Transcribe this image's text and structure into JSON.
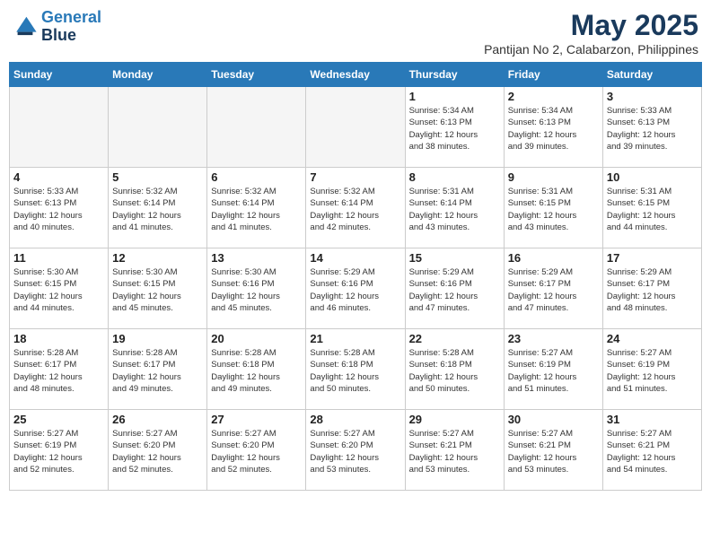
{
  "header": {
    "logo_line1": "General",
    "logo_line2": "Blue",
    "month_title": "May 2025",
    "subtitle": "Pantijan No 2, Calabarzon, Philippines"
  },
  "days_of_week": [
    "Sunday",
    "Monday",
    "Tuesday",
    "Wednesday",
    "Thursday",
    "Friday",
    "Saturday"
  ],
  "weeks": [
    [
      {
        "day": "",
        "info": ""
      },
      {
        "day": "",
        "info": ""
      },
      {
        "day": "",
        "info": ""
      },
      {
        "day": "",
        "info": ""
      },
      {
        "day": "1",
        "info": "Sunrise: 5:34 AM\nSunset: 6:13 PM\nDaylight: 12 hours\nand 38 minutes."
      },
      {
        "day": "2",
        "info": "Sunrise: 5:34 AM\nSunset: 6:13 PM\nDaylight: 12 hours\nand 39 minutes."
      },
      {
        "day": "3",
        "info": "Sunrise: 5:33 AM\nSunset: 6:13 PM\nDaylight: 12 hours\nand 39 minutes."
      }
    ],
    [
      {
        "day": "4",
        "info": "Sunrise: 5:33 AM\nSunset: 6:13 PM\nDaylight: 12 hours\nand 40 minutes."
      },
      {
        "day": "5",
        "info": "Sunrise: 5:32 AM\nSunset: 6:14 PM\nDaylight: 12 hours\nand 41 minutes."
      },
      {
        "day": "6",
        "info": "Sunrise: 5:32 AM\nSunset: 6:14 PM\nDaylight: 12 hours\nand 41 minutes."
      },
      {
        "day": "7",
        "info": "Sunrise: 5:32 AM\nSunset: 6:14 PM\nDaylight: 12 hours\nand 42 minutes."
      },
      {
        "day": "8",
        "info": "Sunrise: 5:31 AM\nSunset: 6:14 PM\nDaylight: 12 hours\nand 43 minutes."
      },
      {
        "day": "9",
        "info": "Sunrise: 5:31 AM\nSunset: 6:15 PM\nDaylight: 12 hours\nand 43 minutes."
      },
      {
        "day": "10",
        "info": "Sunrise: 5:31 AM\nSunset: 6:15 PM\nDaylight: 12 hours\nand 44 minutes."
      }
    ],
    [
      {
        "day": "11",
        "info": "Sunrise: 5:30 AM\nSunset: 6:15 PM\nDaylight: 12 hours\nand 44 minutes."
      },
      {
        "day": "12",
        "info": "Sunrise: 5:30 AM\nSunset: 6:15 PM\nDaylight: 12 hours\nand 45 minutes."
      },
      {
        "day": "13",
        "info": "Sunrise: 5:30 AM\nSunset: 6:16 PM\nDaylight: 12 hours\nand 45 minutes."
      },
      {
        "day": "14",
        "info": "Sunrise: 5:29 AM\nSunset: 6:16 PM\nDaylight: 12 hours\nand 46 minutes."
      },
      {
        "day": "15",
        "info": "Sunrise: 5:29 AM\nSunset: 6:16 PM\nDaylight: 12 hours\nand 47 minutes."
      },
      {
        "day": "16",
        "info": "Sunrise: 5:29 AM\nSunset: 6:17 PM\nDaylight: 12 hours\nand 47 minutes."
      },
      {
        "day": "17",
        "info": "Sunrise: 5:29 AM\nSunset: 6:17 PM\nDaylight: 12 hours\nand 48 minutes."
      }
    ],
    [
      {
        "day": "18",
        "info": "Sunrise: 5:28 AM\nSunset: 6:17 PM\nDaylight: 12 hours\nand 48 minutes."
      },
      {
        "day": "19",
        "info": "Sunrise: 5:28 AM\nSunset: 6:17 PM\nDaylight: 12 hours\nand 49 minutes."
      },
      {
        "day": "20",
        "info": "Sunrise: 5:28 AM\nSunset: 6:18 PM\nDaylight: 12 hours\nand 49 minutes."
      },
      {
        "day": "21",
        "info": "Sunrise: 5:28 AM\nSunset: 6:18 PM\nDaylight: 12 hours\nand 50 minutes."
      },
      {
        "day": "22",
        "info": "Sunrise: 5:28 AM\nSunset: 6:18 PM\nDaylight: 12 hours\nand 50 minutes."
      },
      {
        "day": "23",
        "info": "Sunrise: 5:27 AM\nSunset: 6:19 PM\nDaylight: 12 hours\nand 51 minutes."
      },
      {
        "day": "24",
        "info": "Sunrise: 5:27 AM\nSunset: 6:19 PM\nDaylight: 12 hours\nand 51 minutes."
      }
    ],
    [
      {
        "day": "25",
        "info": "Sunrise: 5:27 AM\nSunset: 6:19 PM\nDaylight: 12 hours\nand 52 minutes."
      },
      {
        "day": "26",
        "info": "Sunrise: 5:27 AM\nSunset: 6:20 PM\nDaylight: 12 hours\nand 52 minutes."
      },
      {
        "day": "27",
        "info": "Sunrise: 5:27 AM\nSunset: 6:20 PM\nDaylight: 12 hours\nand 52 minutes."
      },
      {
        "day": "28",
        "info": "Sunrise: 5:27 AM\nSunset: 6:20 PM\nDaylight: 12 hours\nand 53 minutes."
      },
      {
        "day": "29",
        "info": "Sunrise: 5:27 AM\nSunset: 6:21 PM\nDaylight: 12 hours\nand 53 minutes."
      },
      {
        "day": "30",
        "info": "Sunrise: 5:27 AM\nSunset: 6:21 PM\nDaylight: 12 hours\nand 53 minutes."
      },
      {
        "day": "31",
        "info": "Sunrise: 5:27 AM\nSunset: 6:21 PM\nDaylight: 12 hours\nand 54 minutes."
      }
    ]
  ]
}
